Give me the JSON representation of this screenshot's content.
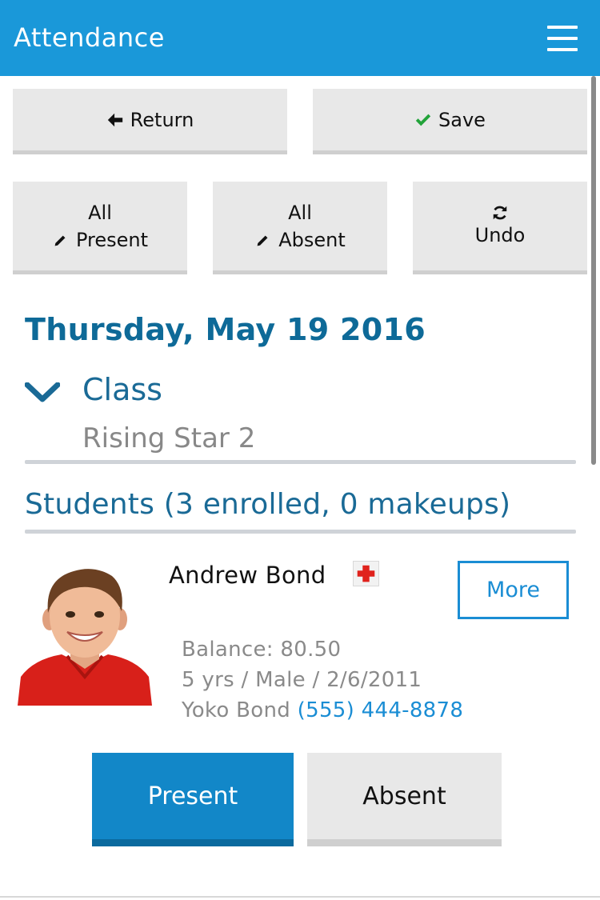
{
  "app": {
    "title": "Attendance",
    "accent_color": "#1a98d9"
  },
  "header": {
    "menu_icon": "hamburger-menu-icon"
  },
  "toolbar": {
    "return_label": "Return",
    "return_icon": "arrow-left-icon",
    "save_label": "Save",
    "save_icon": "checkmark-icon"
  },
  "bulk_actions": {
    "all_present_line1": "All",
    "all_present_line2": "Present",
    "all_present_icon": "pencil-icon",
    "all_absent_line1": "All",
    "all_absent_line2": "Absent",
    "all_absent_icon": "pencil-icon",
    "undo_label": "Undo",
    "undo_icon": "refresh-icon"
  },
  "session": {
    "date_heading": "Thursday, May 19 2016",
    "class_label": "Class",
    "class_value": "Rising Star 2",
    "students_heading": "Students (3 enrolled, 0 makeups)"
  },
  "students": [
    {
      "name": "Andrew Bond",
      "medical_icon": "red-cross-icon",
      "more_label": "More",
      "balance": "Balance: 80.50",
      "details": "5 yrs / Male / 2/6/2011",
      "parent_name": "Yoko Bond",
      "parent_phone": "(555) 444-8878",
      "present_label": "Present",
      "absent_label": "Absent",
      "status": "Present"
    }
  ]
}
